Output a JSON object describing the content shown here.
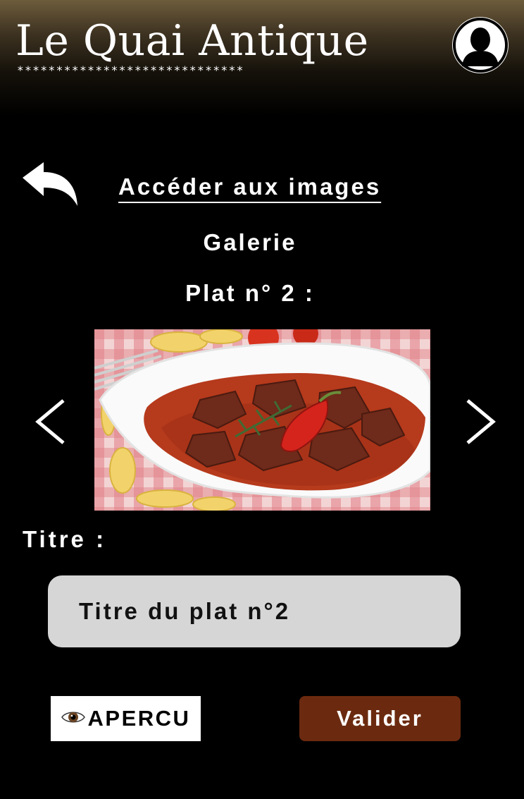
{
  "header": {
    "brand": "Le Quai Antique",
    "stars": "*****************************",
    "profile_icon": "user-avatar-icon"
  },
  "nav": {
    "back_icon": "reply-arrow-icon",
    "access_images_link": "Accéder aux images"
  },
  "gallery": {
    "heading": "Galerie",
    "dish_heading": "Plat n° 2 :",
    "prev_icon": "chevron-left-icon",
    "next_icon": "chevron-right-icon"
  },
  "form": {
    "title_label": "Titre :",
    "title_value": "Titre du plat n°2"
  },
  "actions": {
    "preview_icon": "eye-icon",
    "preview_label": "APERCU",
    "submit_label": "Valider"
  },
  "colors": {
    "background": "#000000",
    "header_top": "#6e5c3c",
    "input_background": "#d6d6d6",
    "submit_button": "#6b2a0f"
  }
}
